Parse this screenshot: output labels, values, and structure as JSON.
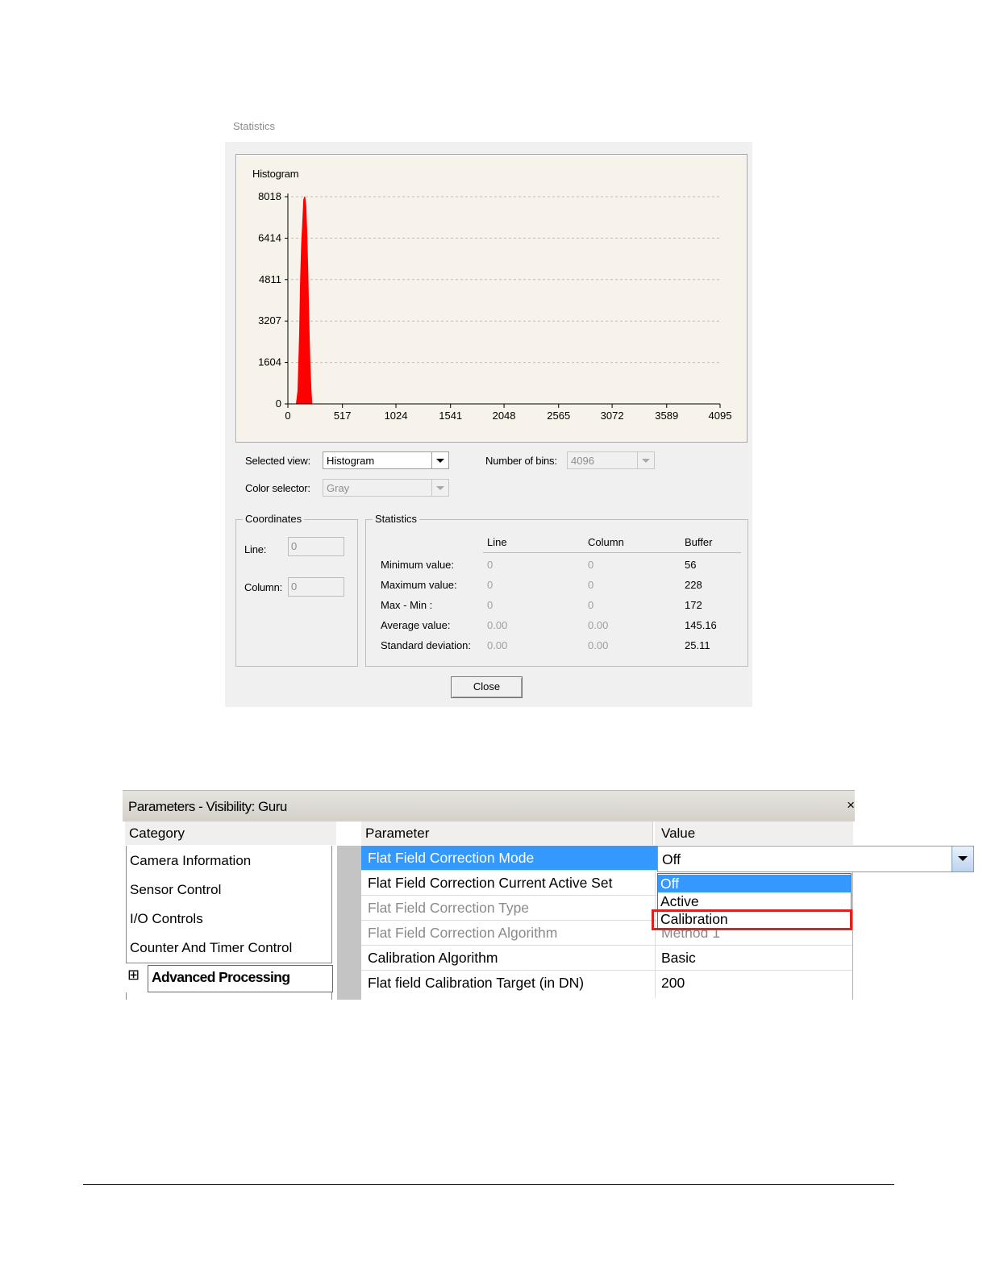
{
  "statistics_dialog": {
    "window_title": "Statistics",
    "histogram_label": "Histogram",
    "selected_view_label": "Selected view:",
    "selected_view_value": "Histogram",
    "number_of_bins_label": "Number of bins:",
    "number_of_bins_value": "4096",
    "color_selector_label": "Color selector:",
    "color_selector_value": "Gray",
    "coordinates": {
      "group_title": "Coordinates",
      "line_label": "Line:",
      "line_value": "0",
      "column_label": "Column:",
      "column_value": "0"
    },
    "statistics": {
      "group_title": "Statistics",
      "columns": [
        "Line",
        "Column",
        "Buffer"
      ],
      "rows": [
        {
          "label": "Minimum value:",
          "line": "0",
          "column": "0",
          "buffer": "56"
        },
        {
          "label": "Maximum value:",
          "line": "0",
          "column": "0",
          "buffer": "228"
        },
        {
          "label": "Max - Min :",
          "line": "0",
          "column": "0",
          "buffer": "172"
        },
        {
          "label": "Average value:",
          "line": "0.00",
          "column": "0.00",
          "buffer": "145.16"
        },
        {
          "label": "Standard deviation:",
          "line": "0.00",
          "column": "0.00",
          "buffer": "25.11"
        }
      ]
    },
    "close_label": "Close",
    "accent_color": "#ff0000"
  },
  "chart_data": {
    "type": "area",
    "title": "Histogram",
    "xlabel": "",
    "ylabel": "",
    "x_ticks": [
      "0",
      "517",
      "1024",
      "1541",
      "2048",
      "2565",
      "3072",
      "3589",
      "4095"
    ],
    "y_ticks": [
      "0",
      "1604",
      "3207",
      "4811",
      "6414",
      "8018"
    ],
    "xlim": [
      0,
      4095
    ],
    "ylim": [
      0,
      8018
    ],
    "grid": "horizontal dashed",
    "series": [
      {
        "color": "#ff0000",
        "x": [
          80,
          95,
          100,
          110,
          120,
          130,
          140,
          150,
          160,
          170,
          180,
          190,
          200,
          210,
          220,
          228
        ],
        "y": [
          0,
          500,
          1200,
          2600,
          4800,
          6200,
          7000,
          7900,
          8018,
          7700,
          6600,
          5000,
          3000,
          1500,
          500,
          0
        ]
      }
    ]
  },
  "parameters_panel": {
    "title": "Parameters - Visibility: Guru",
    "close_glyph": "×",
    "category_header": "Category",
    "parameter_header": "Parameter",
    "value_header": "Value",
    "categories": [
      "Camera Information",
      "Sensor Control",
      "I/O Controls",
      "Counter And Timer Control"
    ],
    "expand_glyph": "⊞",
    "advanced_processing": "Advanced Processing",
    "rows": [
      {
        "name": "Flat Field Correction Mode",
        "value": "Off"
      },
      {
        "name": "Flat Field Correction Current Active Set",
        "value": ""
      },
      {
        "name": "Flat Field Correction Type",
        "value": ""
      },
      {
        "name": "Flat Field Correction Algorithm",
        "value": "Method 1"
      },
      {
        "name": "Calibration Algorithm",
        "value": "Basic"
      },
      {
        "name": "Flat field Calibration Target (in DN)",
        "value": "200"
      }
    ],
    "dropdown_options": [
      "Off",
      "Active",
      "Calibration"
    ],
    "selection_color": "#3399ff",
    "highlight_color": "#e0201f"
  }
}
